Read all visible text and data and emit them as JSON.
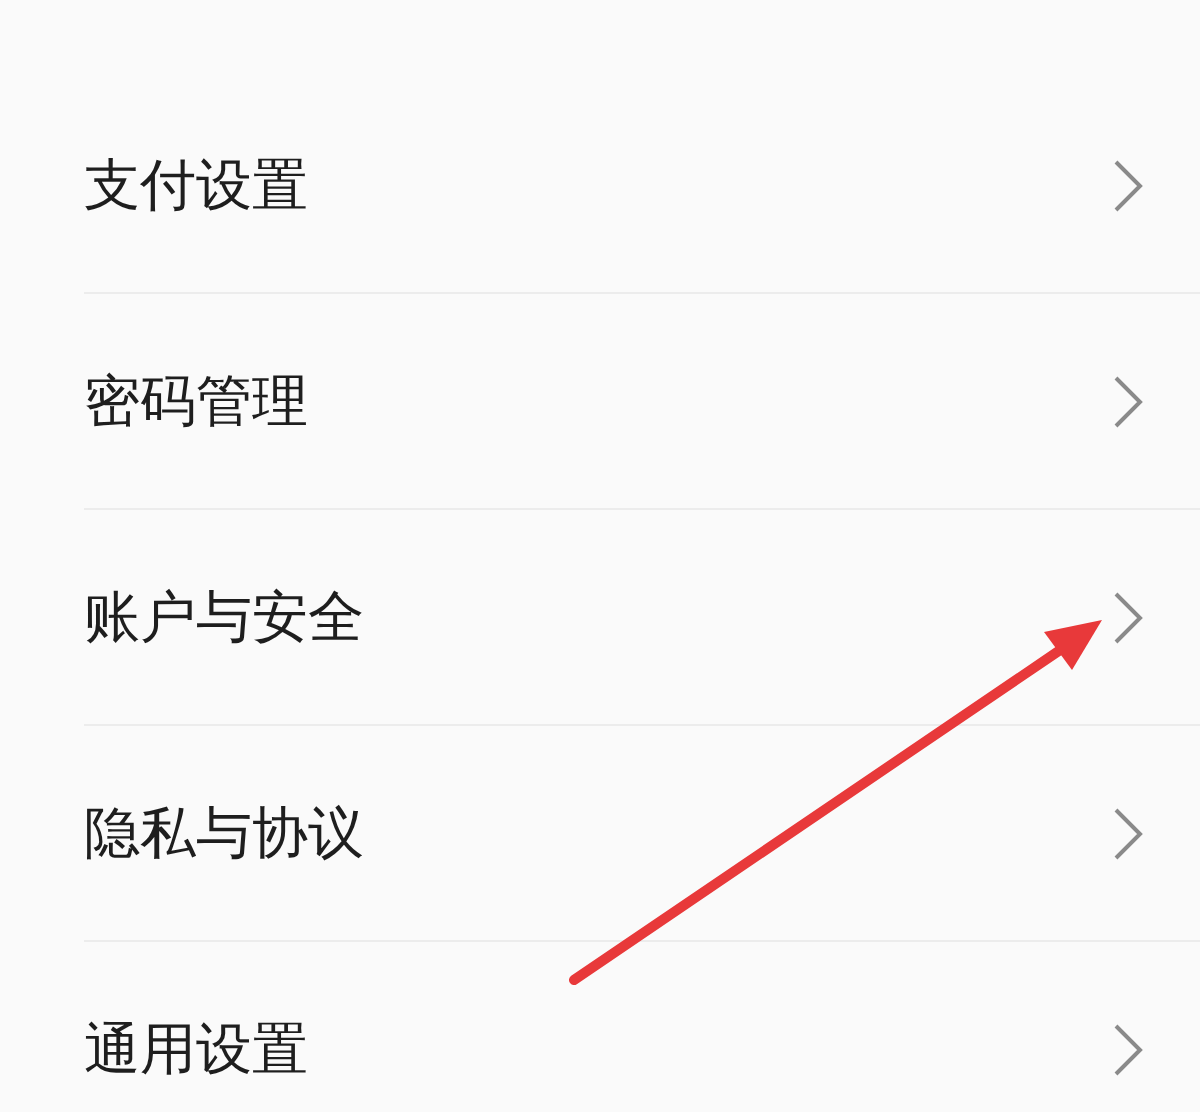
{
  "settings_items": [
    {
      "label": "支付设置"
    },
    {
      "label": "密码管理"
    },
    {
      "label": "账户与安全"
    },
    {
      "label": "隐私与协议"
    },
    {
      "label": "通用设置"
    }
  ]
}
